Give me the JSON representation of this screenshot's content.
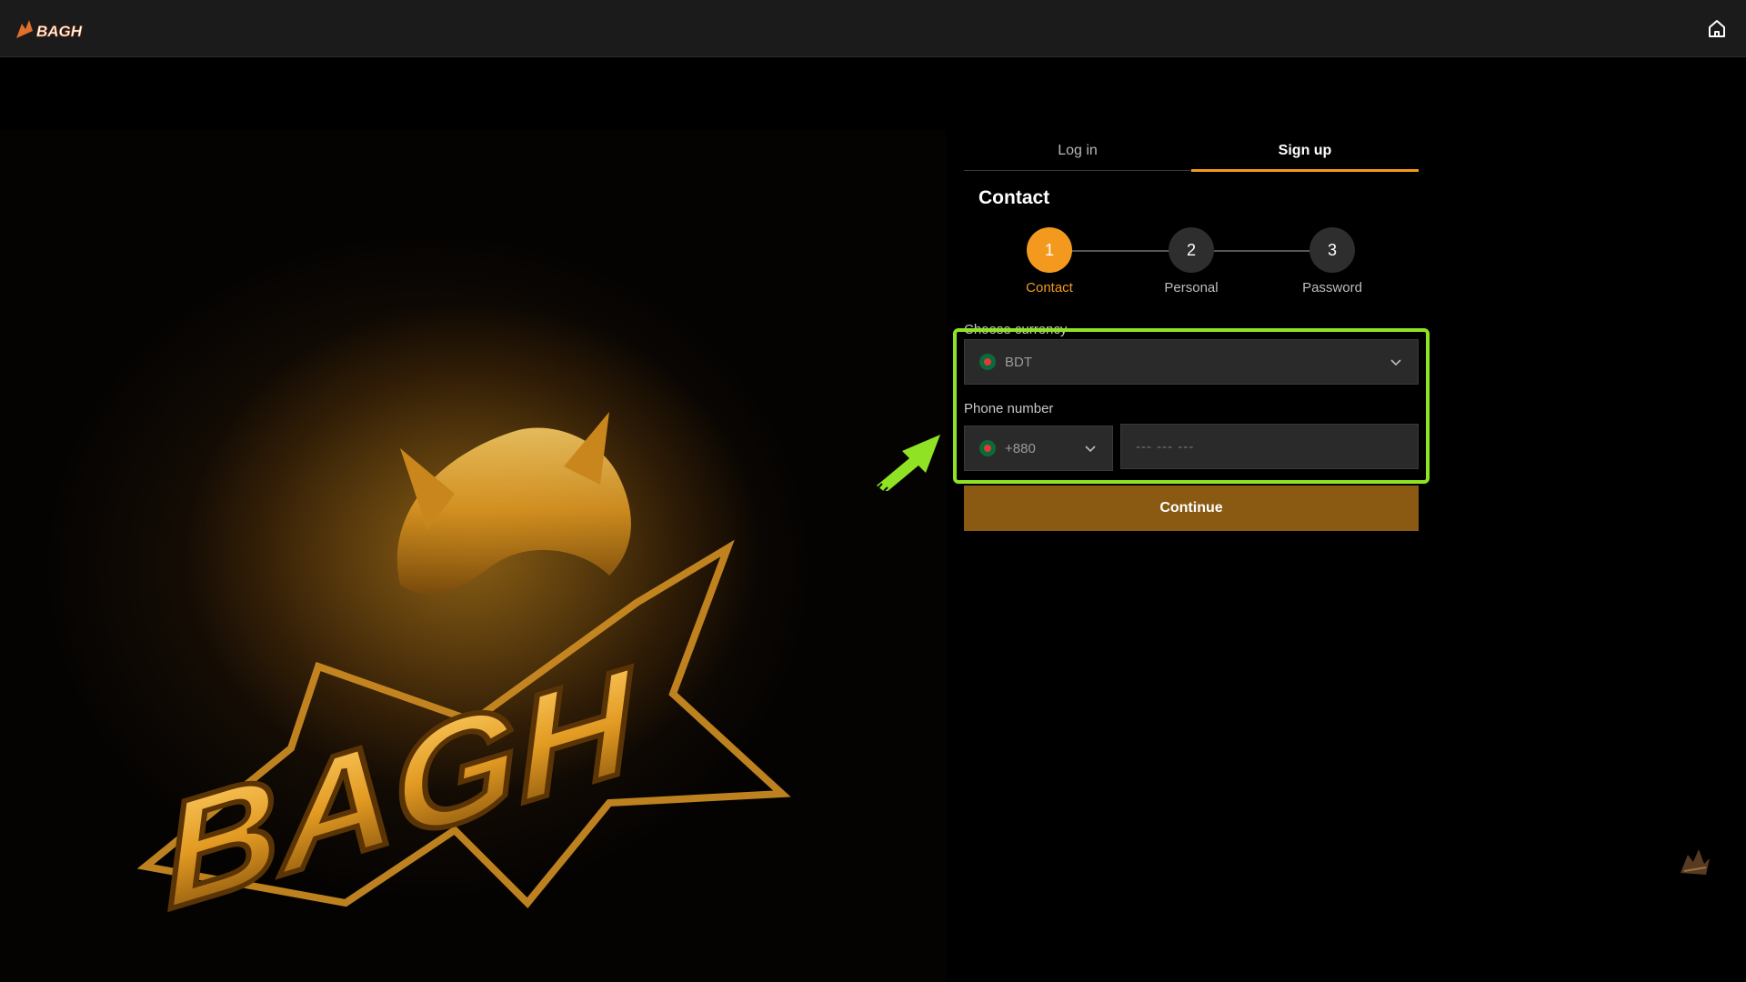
{
  "header": {
    "logo_text": "BAGH",
    "home_icon": "home-icon"
  },
  "hero": {
    "wordmark": "BAGH"
  },
  "auth": {
    "tabs": [
      {
        "label": "Log in",
        "active": false
      },
      {
        "label": "Sign up",
        "active": true
      }
    ],
    "section_title": "Contact",
    "steps": [
      {
        "number": "1",
        "label": "Contact",
        "active": true
      },
      {
        "number": "2",
        "label": "Personal",
        "active": false
      },
      {
        "number": "3",
        "label": "Password",
        "active": false
      }
    ],
    "currency": {
      "label": "Choose currency",
      "value": "BDT",
      "flag_icon": "bangladesh-flag-icon"
    },
    "phone": {
      "label": "Phone number",
      "country_code": "+880",
      "placeholder": "--- --- ---"
    },
    "continue_label": "Continue"
  },
  "colors": {
    "accent": "#f39a1e",
    "highlight": "#8fe324",
    "button": "#8a5a13"
  }
}
